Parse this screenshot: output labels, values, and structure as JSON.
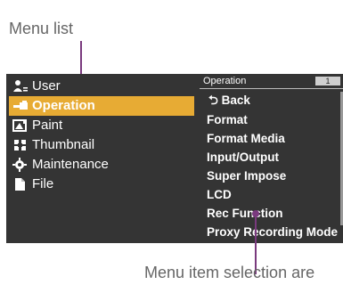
{
  "header_partial": "",
  "labels": {
    "menu_list": "Menu list",
    "menu_item_area": "Menu item selection are"
  },
  "colors": {
    "leader": "#7a3a7e",
    "selected_bg": "#e7ab34",
    "screen_bg": "#343434"
  },
  "menu": {
    "items": [
      {
        "label": "User",
        "icon": "user-icon",
        "selected": false
      },
      {
        "label": "Operation",
        "icon": "operation-icon",
        "selected": true
      },
      {
        "label": "Paint",
        "icon": "paint-icon",
        "selected": false
      },
      {
        "label": "Thumbnail",
        "icon": "thumbnail-icon",
        "selected": false
      },
      {
        "label": "Maintenance",
        "icon": "gear-icon",
        "selected": false
      },
      {
        "label": "File",
        "icon": "file-icon",
        "selected": false
      }
    ]
  },
  "panel": {
    "title": "Operation",
    "page": "1",
    "back_label": "Back",
    "items": [
      "Format",
      "Format Media",
      "Input/Output",
      "Super Impose",
      "LCD",
      "Rec Function",
      "Proxy Recording Mode"
    ]
  }
}
